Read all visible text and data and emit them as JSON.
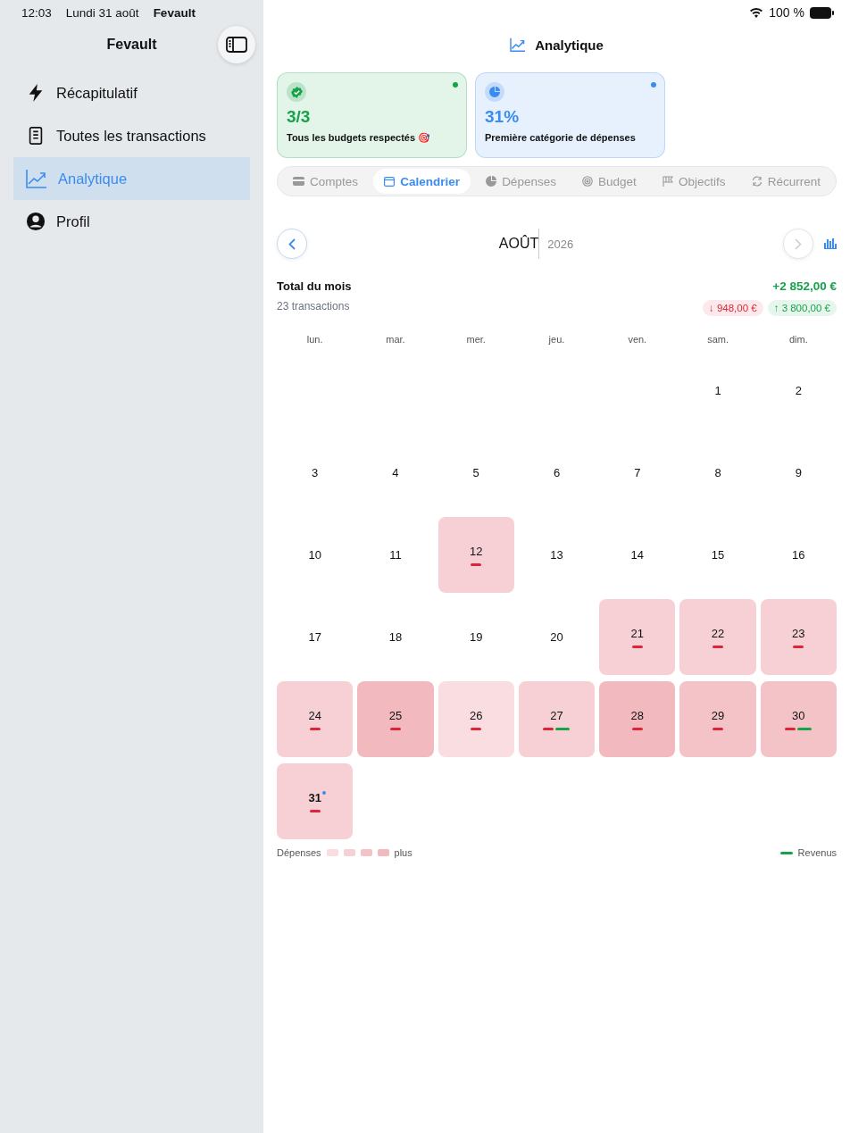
{
  "status_bar": {
    "time": "12:03",
    "date": "Lundi 31 août",
    "app": "Fevault",
    "battery": "100 %"
  },
  "sidebar": {
    "title": "Fevault",
    "items": [
      {
        "label": "Récapitulatif",
        "kind": "bolt",
        "selected": false
      },
      {
        "label": "Toutes les transactions",
        "kind": "list",
        "selected": false
      },
      {
        "label": "Analytique",
        "kind": "chart",
        "selected": true
      },
      {
        "label": "Profil",
        "kind": "person",
        "selected": false
      }
    ]
  },
  "header": {
    "title": "Analytique"
  },
  "cards": [
    {
      "kind": "check",
      "value": "3/3",
      "label": "Tous les budgets respectés 🎯",
      "color": "#16a34a"
    },
    {
      "kind": "pie",
      "value": "31%",
      "label": "Première catégorie de dépenses",
      "color": "#3b8cf0"
    }
  ],
  "tabs": [
    {
      "label": "Comptes",
      "kind": "card",
      "selected": false
    },
    {
      "label": "Calendrier",
      "kind": "calendar",
      "selected": true
    },
    {
      "label": "Dépenses",
      "kind": "pie",
      "selected": false
    },
    {
      "label": "Budget",
      "kind": "target",
      "selected": false
    },
    {
      "label": "Objectifs",
      "kind": "flag",
      "selected": false
    },
    {
      "label": "Récurrent",
      "kind": "repeat",
      "selected": false
    }
  ],
  "month": {
    "name": "AOÛT",
    "year": "2026",
    "next_disabled": true
  },
  "totals": {
    "title": "Total du mois",
    "count": "23 transactions",
    "net": "+2 852,00 €",
    "expenses": "↓ 948,00 €",
    "income": "↑ 3 800,00 €"
  },
  "weekdays": [
    "lun.",
    "mar.",
    "mer.",
    "jeu.",
    "ven.",
    "sam.",
    "dim."
  ],
  "days": [
    {
      "kind": "empty"
    },
    {
      "kind": "empty"
    },
    {
      "kind": "empty"
    },
    {
      "kind": "empty"
    },
    {
      "kind": "empty"
    },
    {
      "kind": "plain",
      "label": "1"
    },
    {
      "kind": "plain",
      "label": "2"
    },
    {
      "kind": "plain",
      "label": "3"
    },
    {
      "kind": "plain",
      "label": "4"
    },
    {
      "kind": "plain",
      "label": "5"
    },
    {
      "kind": "plain",
      "label": "6"
    },
    {
      "kind": "plain",
      "label": "7"
    },
    {
      "kind": "plain",
      "label": "8"
    },
    {
      "kind": "plain",
      "label": "9"
    },
    {
      "kind": "plain",
      "label": "10"
    },
    {
      "kind": "plain",
      "label": "11"
    },
    {
      "kind": "spend",
      "label": "12",
      "color": "#f6d0d5",
      "expense": true,
      "income": false,
      "today": false
    },
    {
      "kind": "plain",
      "label": "13"
    },
    {
      "kind": "plain",
      "label": "14"
    },
    {
      "kind": "plain",
      "label": "15"
    },
    {
      "kind": "plain",
      "label": "16"
    },
    {
      "kind": "plain",
      "label": "17"
    },
    {
      "kind": "plain",
      "label": "18"
    },
    {
      "kind": "plain",
      "label": "19"
    },
    {
      "kind": "plain",
      "label": "20"
    },
    {
      "kind": "spend",
      "label": "21",
      "color": "#f6d0d5",
      "expense": true,
      "income": false,
      "today": false
    },
    {
      "kind": "spend",
      "label": "22",
      "color": "#f6d0d5",
      "expense": true,
      "income": false,
      "today": false
    },
    {
      "kind": "spend",
      "label": "23",
      "color": "#f6d0d5",
      "expense": true,
      "income": false,
      "today": false
    },
    {
      "kind": "spend",
      "label": "24",
      "color": "#f6d0d5",
      "expense": true,
      "income": false,
      "today": false
    },
    {
      "kind": "spend",
      "label": "25",
      "color": "#f2b9bf",
      "expense": true,
      "income": false,
      "today": false
    },
    {
      "kind": "spend",
      "label": "26",
      "color": "#f9dde1",
      "expense": true,
      "income": false,
      "today": false
    },
    {
      "kind": "spend",
      "label": "27",
      "color": "#f6d0d5",
      "expense": true,
      "income": true,
      "today": false
    },
    {
      "kind": "spend",
      "label": "28",
      "color": "#f2b9bf",
      "expense": true,
      "income": false,
      "today": false
    },
    {
      "kind": "spend",
      "label": "29",
      "color": "#f3c3c8",
      "expense": true,
      "income": false,
      "today": false
    },
    {
      "kind": "spend",
      "label": "30",
      "color": "#f3c3c8",
      "expense": true,
      "income": true,
      "today": false
    },
    {
      "kind": "spend",
      "label": "31",
      "color": "#f6d0d5",
      "expense": true,
      "income": false,
      "today": true
    }
  ],
  "legend": {
    "expenses": "Dépenses",
    "more": "plus",
    "income": "Revenus"
  }
}
